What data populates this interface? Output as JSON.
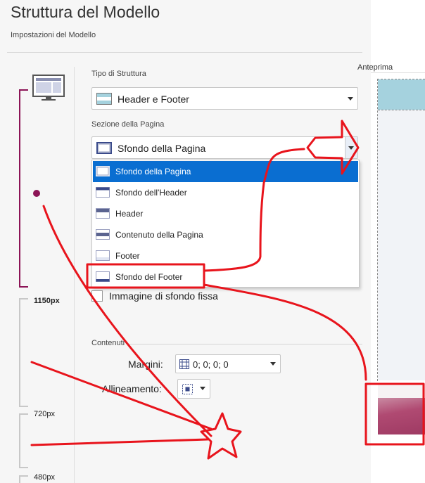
{
  "header": {
    "title": "Struttura del Modello",
    "subtitle": "Impostazioni del Modello"
  },
  "ruler": {
    "breakpoints": [
      "1150px",
      "720px",
      "480px"
    ]
  },
  "structure_type": {
    "label": "Tipo di Struttura",
    "value": "Header e Footer"
  },
  "page_section": {
    "label": "Sezione della Pagina",
    "value": "Sfondo della Pagina",
    "options": [
      "Sfondo della Pagina",
      "Sfondo dell'Header",
      "Header",
      "Contenuto della Pagina",
      "Footer",
      "Sfondo del Footer"
    ],
    "selected_index": 0
  },
  "fixed_background": {
    "label": "Immagine di sfondo fissa",
    "checked": false
  },
  "contents": {
    "label": "Contenuti",
    "margins_label": "Margini:",
    "margins_value": "0; 0; 0; 0",
    "alignment_label": "Allineamento:"
  },
  "preview": {
    "label": "Anteprima"
  },
  "colors": {
    "accent": "#8c1456",
    "selection": "#0a6ed1",
    "annotation": "#e8141c",
    "preview_header": "#a5d2de"
  }
}
